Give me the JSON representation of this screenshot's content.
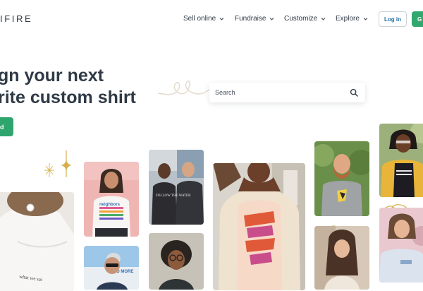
{
  "brand": {
    "logo_text": "IFIRE"
  },
  "nav": {
    "items": [
      {
        "label": "Sell online"
      },
      {
        "label": "Fundraise"
      },
      {
        "label": "Customize"
      },
      {
        "label": "Explore"
      }
    ],
    "login_label": "Log in",
    "cta_label": "G"
  },
  "hero": {
    "headline_line1": "gn your next",
    "headline_line2": "rite custom shirt",
    "button_label": "d"
  },
  "search": {
    "placeholder": "Search"
  },
  "gallery": {
    "tee_text_neighbors": "neighbors",
    "tee_text_water": "FOLLOW THE WATER",
    "tee_text_more": "EO MORE",
    "hoodie_text": "what we sai"
  },
  "colors": {
    "brand_green": "#33a86e",
    "login_text": "#1d6ea8",
    "heading": "#2f3a45",
    "accent_gold": "#d6b04a"
  },
  "icons": {
    "search": "search-icon",
    "chevron": "chevron-down-icon"
  }
}
